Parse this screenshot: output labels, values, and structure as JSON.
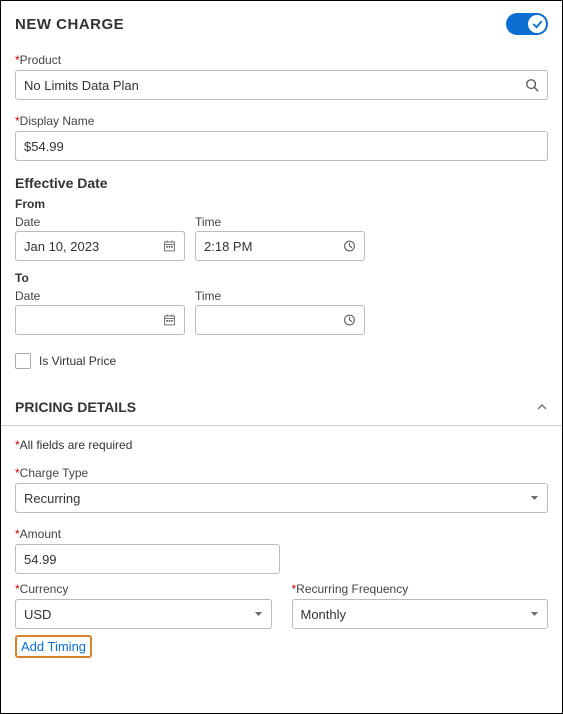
{
  "header": {
    "title": "NEW CHARGE"
  },
  "product": {
    "label": "Product",
    "value": "No Limits Data Plan"
  },
  "displayName": {
    "label": "Display Name",
    "value": "$54.99"
  },
  "effectiveDate": {
    "title": "Effective Date",
    "fromLabel": "From",
    "toLabel": "To",
    "dateLabel": "Date",
    "timeLabel": "Time",
    "fromDate": "Jan 10, 2023",
    "fromTime": "2:18 PM",
    "toDate": "",
    "toTime": ""
  },
  "virtualPrice": {
    "label": "Is Virtual Price"
  },
  "pricing": {
    "title": "PRICING DETAILS",
    "note": "All fields are required",
    "chargeType": {
      "label": "Charge Type",
      "value": "Recurring"
    },
    "amount": {
      "label": "Amount",
      "value": "54.99"
    },
    "currency": {
      "label": "Currency",
      "value": "USD"
    },
    "frequency": {
      "label": "Recurring Frequency",
      "value": "Monthly"
    },
    "addTiming": "Add Timing"
  }
}
